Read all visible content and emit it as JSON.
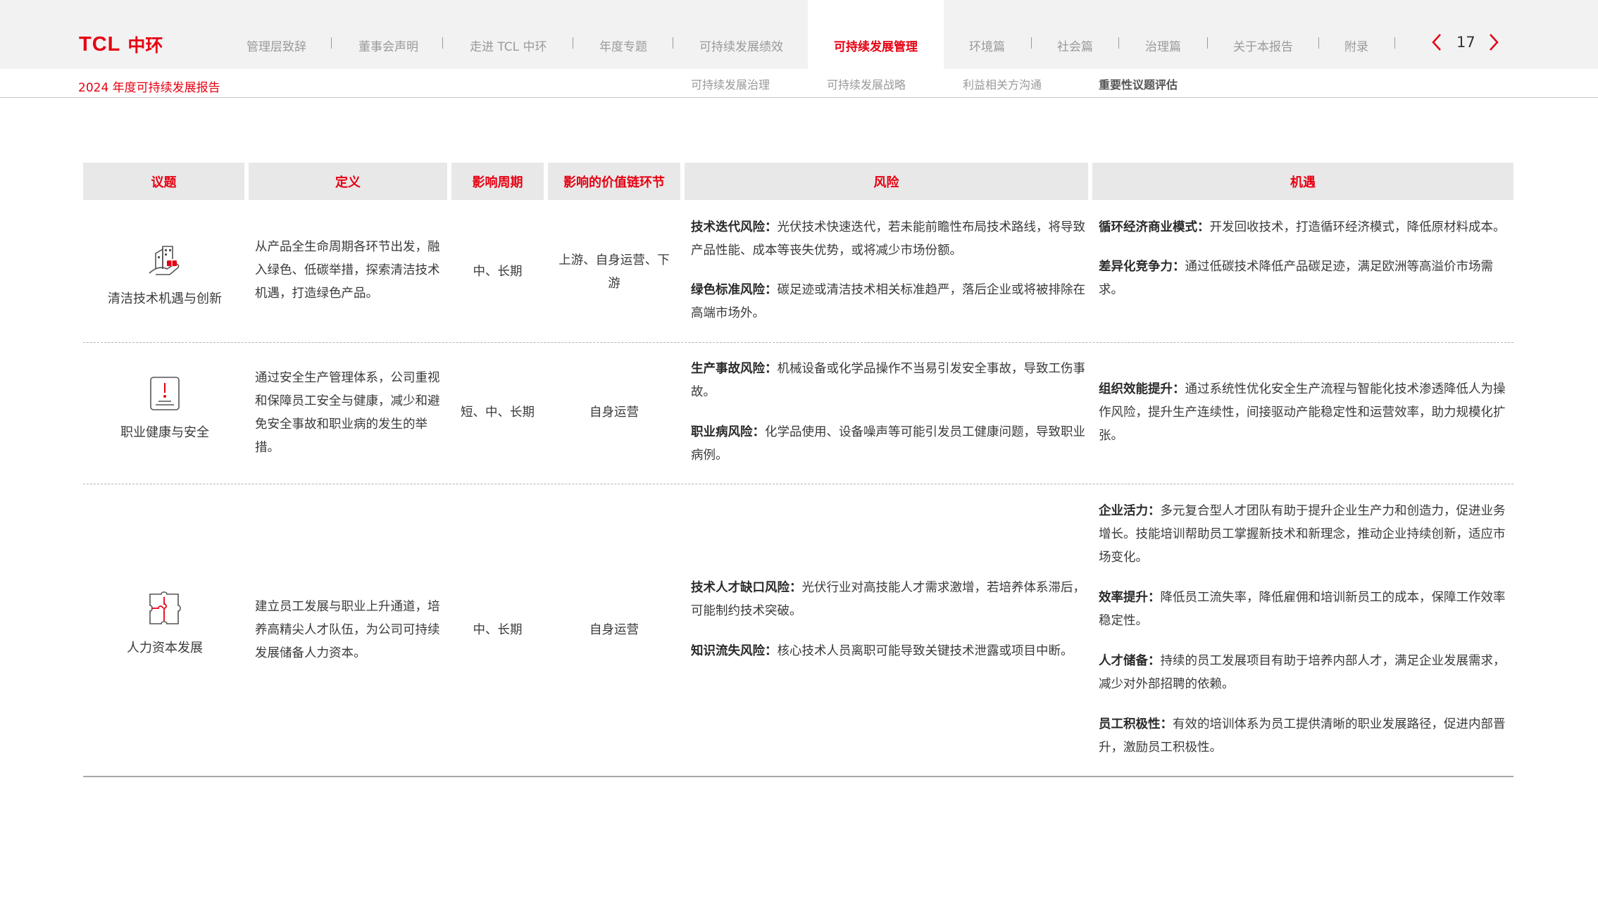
{
  "header": {
    "logo_text": "TCL",
    "logo_cn": "中环",
    "report_title": "2024 年度可持续发展报告",
    "nav": [
      {
        "label": "管理层致辞"
      },
      {
        "label": "董事会声明"
      },
      {
        "label": "走进 TCL 中环"
      },
      {
        "label": "年度专题"
      },
      {
        "label": "可持续发展绩效"
      },
      {
        "label": "可持续发展管理"
      },
      {
        "label": "环境篇"
      },
      {
        "label": "社会篇"
      },
      {
        "label": "治理篇"
      },
      {
        "label": "关于本报告"
      },
      {
        "label": "附录"
      }
    ],
    "active_nav": "可持续发展管理",
    "page_number": "17",
    "subnav": [
      {
        "label": "可持续发展治理"
      },
      {
        "label": "可持续发展战略"
      },
      {
        "label": "利益相关方沟通"
      },
      {
        "label": "重要性议题评估"
      }
    ],
    "active_subnav": "重要性议题评估"
  },
  "table": {
    "headers": [
      "议题",
      "定义",
      "影响周期",
      "影响的价值链环节",
      "风险",
      "机遇"
    ],
    "rows": [
      {
        "topic": "清洁技术机遇与创新",
        "icon": "clean-tech-icon",
        "definition": "从产品全生命周期各环节出发，融入绿色、低碳举措，探索清洁技术机遇，打造绿色产品。",
        "period": "中、长期",
        "value_chain": "上游、自身运营、下游",
        "risks": [
          {
            "title": "技术迭代风险：",
            "text": "光伏技术快速迭代，若未能前瞻性布局技术路线，将导致产品性能、成本等丧失优势，或将减少市场份额。"
          },
          {
            "title": "绿色标准风险：",
            "text": "碳足迹或清洁技术相关标准趋严，落后企业或将被排除在高端市场外。"
          }
        ],
        "opportunities": [
          {
            "title": "循环经济商业模式：",
            "text": "开发回收技术，打造循环经济模式，降低原材料成本。"
          },
          {
            "title": "差异化竞争力：",
            "text": "通过低碳技术降低产品碳足迹，满足欧洲等高溢价市场需求。"
          }
        ]
      },
      {
        "topic": "职业健康与安全",
        "icon": "safety-icon",
        "definition": "通过安全生产管理体系，公司重视和保障员工安全与健康，减少和避免安全事故和职业病的发生的举措。",
        "period": "短、中、长期",
        "value_chain": "自身运营",
        "risks": [
          {
            "title": "生产事故风险：",
            "text": "机械设备或化学品操作不当易引发安全事故，导致工伤事故。"
          },
          {
            "title": "职业病风险：",
            "text": "化学品使用、设备噪声等可能引发员工健康问题，导致职业病例。"
          }
        ],
        "opportunities": [
          {
            "title": "组织效能提升：",
            "text": "通过系统性优化安全生产流程与智能化技术渗透降低人为操作风险，提升生产连续性，间接驱动产能稳定性和运营效率，助力规模化扩张。"
          }
        ]
      },
      {
        "topic": "人力资本发展",
        "icon": "puzzle-icon",
        "definition": "建立员工发展与职业上升通道，培养高精尖人才队伍，为公司可持续发展储备人力资本。",
        "period": "中、长期",
        "value_chain": "自身运营",
        "risks": [
          {
            "title": "技术人才缺口风险：",
            "text": "光伏行业对高技能人才需求激增，若培养体系滞后，可能制约技术突破。"
          },
          {
            "title": "知识流失风险：",
            "text": "核心技术人员离职可能导致关键技术泄露或项目中断。"
          }
        ],
        "opportunities": [
          {
            "title": "企业活力：",
            "text": "多元复合型人才团队有助于提升企业生产力和创造力，促进业务增长。技能培训帮助员工掌握新技术和新理念，推动企业持续创新，适应市场变化。"
          },
          {
            "title": "效率提升：",
            "text": "降低员工流失率，降低雇佣和培训新员工的成本，保障工作效率稳定性。"
          },
          {
            "title": "人才储备：",
            "text": "持续的员工发展项目有助于培养内部人才，满足企业发展需求，减少对外部招聘的依赖。"
          },
          {
            "title": "员工积极性：",
            "text": "有效的培训体系为员工提供清晰的职业发展路径，促进内部晋升，激励员工积极性。"
          }
        ]
      }
    ]
  },
  "colors": {
    "accent": "#e60012",
    "header_bg": "#e8e8e8",
    "topbar_bg": "#f2f2f2"
  }
}
